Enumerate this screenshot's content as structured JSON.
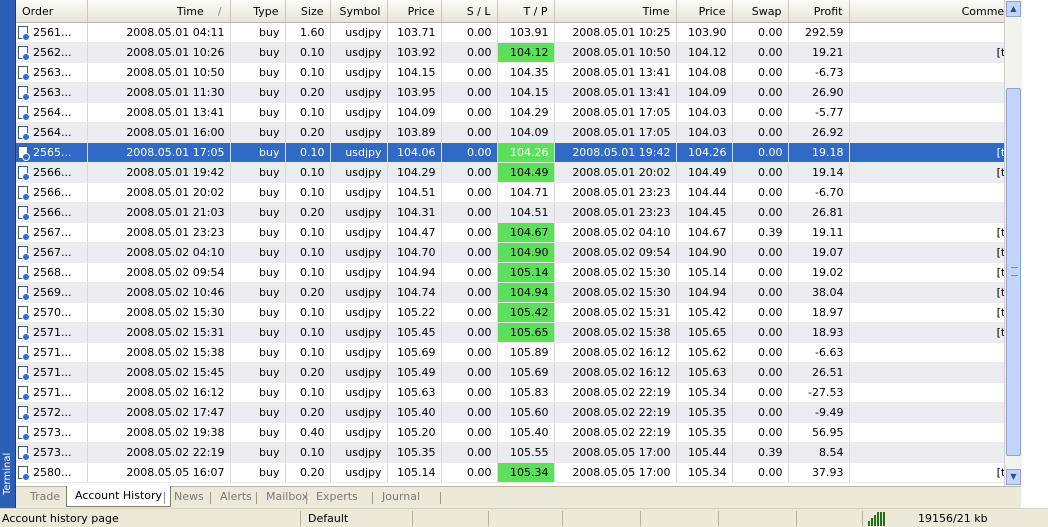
{
  "terminal_label": "Terminal",
  "columns": [
    "Order",
    "Time",
    "Type",
    "Size",
    "Symbol",
    "Price",
    "S / L",
    "T / P",
    "Time",
    "Price",
    "Swap",
    "Profit",
    "Comment"
  ],
  "sort_indicator": "/",
  "rows": [
    {
      "order": "2561...",
      "open_time": "2008.05.01 04:11",
      "type": "buy",
      "size": "1.60",
      "symbol": "usdjpy",
      "open_price": "103.71",
      "sl": "0.00",
      "tp": "103.91",
      "close_time": "2008.05.01 10:25",
      "close_price": "103.90",
      "swap": "0.00",
      "profit": "292.59",
      "comment": "",
      "tp_hit": false
    },
    {
      "order": "2562...",
      "open_time": "2008.05.01 10:26",
      "type": "buy",
      "size": "0.10",
      "symbol": "usdjpy",
      "open_price": "103.92",
      "sl": "0.00",
      "tp": "104.12",
      "close_time": "2008.05.01 10:50",
      "close_price": "104.12",
      "swap": "0.00",
      "profit": "19.21",
      "comment": "[tp]",
      "tp_hit": true
    },
    {
      "order": "2563...",
      "open_time": "2008.05.01 10:50",
      "type": "buy",
      "size": "0.10",
      "symbol": "usdjpy",
      "open_price": "104.15",
      "sl": "0.00",
      "tp": "104.35",
      "close_time": "2008.05.01 13:41",
      "close_price": "104.08",
      "swap": "0.00",
      "profit": "-6.73",
      "comment": "",
      "tp_hit": false
    },
    {
      "order": "2563...",
      "open_time": "2008.05.01 11:30",
      "type": "buy",
      "size": "0.20",
      "symbol": "usdjpy",
      "open_price": "103.95",
      "sl": "0.00",
      "tp": "104.15",
      "close_time": "2008.05.01 13:41",
      "close_price": "104.09",
      "swap": "0.00",
      "profit": "26.90",
      "comment": "",
      "tp_hit": false
    },
    {
      "order": "2564...",
      "open_time": "2008.05.01 13:41",
      "type": "buy",
      "size": "0.10",
      "symbol": "usdjpy",
      "open_price": "104.09",
      "sl": "0.00",
      "tp": "104.29",
      "close_time": "2008.05.01 17:05",
      "close_price": "104.03",
      "swap": "0.00",
      "profit": "-5.77",
      "comment": "",
      "tp_hit": false
    },
    {
      "order": "2564...",
      "open_time": "2008.05.01 16:00",
      "type": "buy",
      "size": "0.20",
      "symbol": "usdjpy",
      "open_price": "103.89",
      "sl": "0.00",
      "tp": "104.09",
      "close_time": "2008.05.01 17:05",
      "close_price": "104.03",
      "swap": "0.00",
      "profit": "26.92",
      "comment": "",
      "tp_hit": false
    },
    {
      "order": "2565...",
      "open_time": "2008.05.01 17:05",
      "type": "buy",
      "size": "0.10",
      "symbol": "usdjpy",
      "open_price": "104.06",
      "sl": "0.00",
      "tp": "104.26",
      "close_time": "2008.05.01 19:42",
      "close_price": "104.26",
      "swap": "0.00",
      "profit": "19.18",
      "comment": "[tp]",
      "tp_hit": true,
      "selected": true
    },
    {
      "order": "2566...",
      "open_time": "2008.05.01 19:42",
      "type": "buy",
      "size": "0.10",
      "symbol": "usdjpy",
      "open_price": "104.29",
      "sl": "0.00",
      "tp": "104.49",
      "close_time": "2008.05.01 20:02",
      "close_price": "104.49",
      "swap": "0.00",
      "profit": "19.14",
      "comment": "[tp]",
      "tp_hit": true
    },
    {
      "order": "2566...",
      "open_time": "2008.05.01 20:02",
      "type": "buy",
      "size": "0.10",
      "symbol": "usdjpy",
      "open_price": "104.51",
      "sl": "0.00",
      "tp": "104.71",
      "close_time": "2008.05.01 23:23",
      "close_price": "104.44",
      "swap": "0.00",
      "profit": "-6.70",
      "comment": "",
      "tp_hit": false
    },
    {
      "order": "2566...",
      "open_time": "2008.05.01 21:03",
      "type": "buy",
      "size": "0.20",
      "symbol": "usdjpy",
      "open_price": "104.31",
      "sl": "0.00",
      "tp": "104.51",
      "close_time": "2008.05.01 23:23",
      "close_price": "104.45",
      "swap": "0.00",
      "profit": "26.81",
      "comment": "",
      "tp_hit": false
    },
    {
      "order": "2567...",
      "open_time": "2008.05.01 23:23",
      "type": "buy",
      "size": "0.10",
      "symbol": "usdjpy",
      "open_price": "104.47",
      "sl": "0.00",
      "tp": "104.67",
      "close_time": "2008.05.02 04:10",
      "close_price": "104.67",
      "swap": "0.39",
      "profit": "19.11",
      "comment": "[tp]",
      "tp_hit": true
    },
    {
      "order": "2567...",
      "open_time": "2008.05.02 04:10",
      "type": "buy",
      "size": "0.10",
      "symbol": "usdjpy",
      "open_price": "104.70",
      "sl": "0.00",
      "tp": "104.90",
      "close_time": "2008.05.02 09:54",
      "close_price": "104.90",
      "swap": "0.00",
      "profit": "19.07",
      "comment": "[tp]",
      "tp_hit": true
    },
    {
      "order": "2568...",
      "open_time": "2008.05.02 09:54",
      "type": "buy",
      "size": "0.10",
      "symbol": "usdjpy",
      "open_price": "104.94",
      "sl": "0.00",
      "tp": "105.14",
      "close_time": "2008.05.02 15:30",
      "close_price": "105.14",
      "swap": "0.00",
      "profit": "19.02",
      "comment": "[tp]",
      "tp_hit": true
    },
    {
      "order": "2569...",
      "open_time": "2008.05.02 10:46",
      "type": "buy",
      "size": "0.20",
      "symbol": "usdjpy",
      "open_price": "104.74",
      "sl": "0.00",
      "tp": "104.94",
      "close_time": "2008.05.02 15:30",
      "close_price": "104.94",
      "swap": "0.00",
      "profit": "38.04",
      "comment": "[tp]",
      "tp_hit": true
    },
    {
      "order": "2570...",
      "open_time": "2008.05.02 15:30",
      "type": "buy",
      "size": "0.10",
      "symbol": "usdjpy",
      "open_price": "105.22",
      "sl": "0.00",
      "tp": "105.42",
      "close_time": "2008.05.02 15:31",
      "close_price": "105.42",
      "swap": "0.00",
      "profit": "18.97",
      "comment": "[tp]",
      "tp_hit": true
    },
    {
      "order": "2571...",
      "open_time": "2008.05.02 15:31",
      "type": "buy",
      "size": "0.10",
      "symbol": "usdjpy",
      "open_price": "105.45",
      "sl": "0.00",
      "tp": "105.65",
      "close_time": "2008.05.02 15:38",
      "close_price": "105.65",
      "swap": "0.00",
      "profit": "18.93",
      "comment": "[tp]",
      "tp_hit": true
    },
    {
      "order": "2571...",
      "open_time": "2008.05.02 15:38",
      "type": "buy",
      "size": "0.10",
      "symbol": "usdjpy",
      "open_price": "105.69",
      "sl": "0.00",
      "tp": "105.89",
      "close_time": "2008.05.02 16:12",
      "close_price": "105.62",
      "swap": "0.00",
      "profit": "-6.63",
      "comment": "",
      "tp_hit": false
    },
    {
      "order": "2571...",
      "open_time": "2008.05.02 15:45",
      "type": "buy",
      "size": "0.20",
      "symbol": "usdjpy",
      "open_price": "105.49",
      "sl": "0.00",
      "tp": "105.69",
      "close_time": "2008.05.02 16:12",
      "close_price": "105.63",
      "swap": "0.00",
      "profit": "26.51",
      "comment": "",
      "tp_hit": false
    },
    {
      "order": "2571...",
      "open_time": "2008.05.02 16:12",
      "type": "buy",
      "size": "0.10",
      "symbol": "usdjpy",
      "open_price": "105.63",
      "sl": "0.00",
      "tp": "105.83",
      "close_time": "2008.05.02 22:19",
      "close_price": "105.34",
      "swap": "0.00",
      "profit": "-27.53",
      "comment": "",
      "tp_hit": false
    },
    {
      "order": "2572...",
      "open_time": "2008.05.02 17:47",
      "type": "buy",
      "size": "0.20",
      "symbol": "usdjpy",
      "open_price": "105.40",
      "sl": "0.00",
      "tp": "105.60",
      "close_time": "2008.05.02 22:19",
      "close_price": "105.35",
      "swap": "0.00",
      "profit": "-9.49",
      "comment": "",
      "tp_hit": false
    },
    {
      "order": "2573...",
      "open_time": "2008.05.02 19:38",
      "type": "buy",
      "size": "0.40",
      "symbol": "usdjpy",
      "open_price": "105.20",
      "sl": "0.00",
      "tp": "105.40",
      "close_time": "2008.05.02 22:19",
      "close_price": "105.35",
      "swap": "0.00",
      "profit": "56.95",
      "comment": "",
      "tp_hit": false
    },
    {
      "order": "2573...",
      "open_time": "2008.05.02 22:19",
      "type": "buy",
      "size": "0.10",
      "symbol": "usdjpy",
      "open_price": "105.35",
      "sl": "0.00",
      "tp": "105.55",
      "close_time": "2008.05.05 17:00",
      "close_price": "105.44",
      "swap": "0.39",
      "profit": "8.54",
      "comment": "",
      "tp_hit": false
    },
    {
      "order": "2580...",
      "open_time": "2008.05.05 16:07",
      "type": "buy",
      "size": "0.20",
      "symbol": "usdjpy",
      "open_price": "105.14",
      "sl": "0.00",
      "tp": "105.34",
      "close_time": "2008.05.05 17:00",
      "close_price": "105.34",
      "swap": "0.00",
      "profit": "37.93",
      "comment": "[tp]",
      "tp_hit": true
    }
  ],
  "tabs": [
    {
      "label": "Trade",
      "active": false
    },
    {
      "label": "Account History",
      "active": true
    },
    {
      "label": "News",
      "active": false
    },
    {
      "label": "Alerts",
      "active": false
    },
    {
      "label": "Mailbox",
      "active": false
    },
    {
      "label": "Experts",
      "active": false
    },
    {
      "label": "Journal",
      "active": false
    }
  ],
  "status": {
    "left": "Account history page",
    "profile": "Default",
    "traffic": "19156/21 kb"
  },
  "colors": {
    "selection": "#316ac5",
    "tp_hit": "#5ce05c",
    "terminal_strip": "#2a5fb5"
  }
}
